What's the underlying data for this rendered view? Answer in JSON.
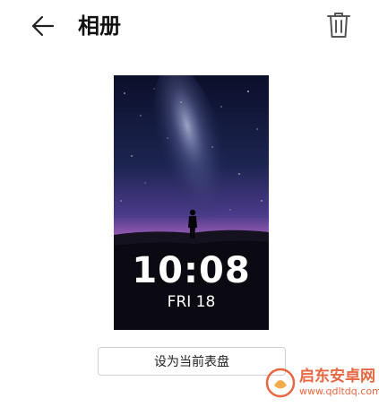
{
  "header": {
    "title": "相册",
    "back_icon": "arrow-left-icon",
    "delete_icon": "trash-icon"
  },
  "preview": {
    "time": "10:08",
    "date": "FRI 18"
  },
  "actions": {
    "set_watchface_label": "设为当前表盘"
  },
  "watermark": {
    "brand": "启东安卓网",
    "url": "www.qdltdq.com"
  },
  "colors": {
    "watermark_accent": "#e4572e"
  }
}
